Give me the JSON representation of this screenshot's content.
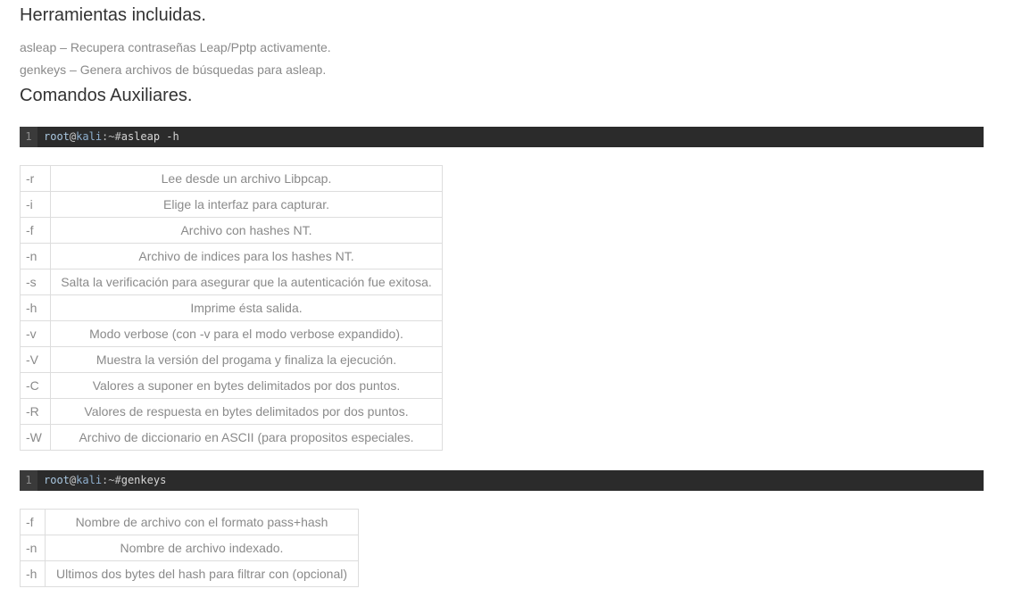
{
  "headings": {
    "tools": "Herramientas incluidas.",
    "aux": "Comandos Auxiliares."
  },
  "tools": [
    "asleap – Recupera contraseñas Leap/Pptp activamente.",
    "genkeys – Genera archivos de búsquedas para asleap."
  ],
  "code_blocks": [
    {
      "line": "1",
      "user": "root",
      "at": "@",
      "host": "kali",
      "prompt": ":~#",
      "command": "asleap -h"
    },
    {
      "line": "1",
      "user": "root",
      "at": "@",
      "host": "kali",
      "prompt": ":~#",
      "command": "genkeys"
    }
  ],
  "asleap_options": [
    {
      "flag": "-r",
      "desc": "Lee desde un archivo Libpcap."
    },
    {
      "flag": "-i",
      "desc": "Elige la interfaz para capturar."
    },
    {
      "flag": "-f",
      "desc": "Archivo con hashes NT."
    },
    {
      "flag": "-n",
      "desc": "Archivo de indices para los hashes NT."
    },
    {
      "flag": "-s",
      "desc": "Salta la verificación para asegurar que la autenticación fue exitosa."
    },
    {
      "flag": "-h",
      "desc": "Imprime ésta salida."
    },
    {
      "flag": "-v",
      "desc": "Modo verbose (con -v para el modo verbose expandido)."
    },
    {
      "flag": "-V",
      "desc": "Muestra la versión del progama y finaliza la ejecución."
    },
    {
      "flag": "-C",
      "desc": "Valores a suponer en bytes delimitados por dos puntos."
    },
    {
      "flag": "-R",
      "desc": "Valores de respuesta en bytes delimitados por dos puntos."
    },
    {
      "flag": "-W",
      "desc": "Archivo de diccionario en ASCII (para propositos especiales."
    }
  ],
  "genkeys_options": [
    {
      "flag": "-f",
      "desc": "Nombre de archivo con el formato pass+hash"
    },
    {
      "flag": "-n",
      "desc": "Nombre de archivo indexado."
    },
    {
      "flag": "-h",
      "desc": "Ultimos dos bytes del hash para filtrar con (opcional)"
    }
  ]
}
